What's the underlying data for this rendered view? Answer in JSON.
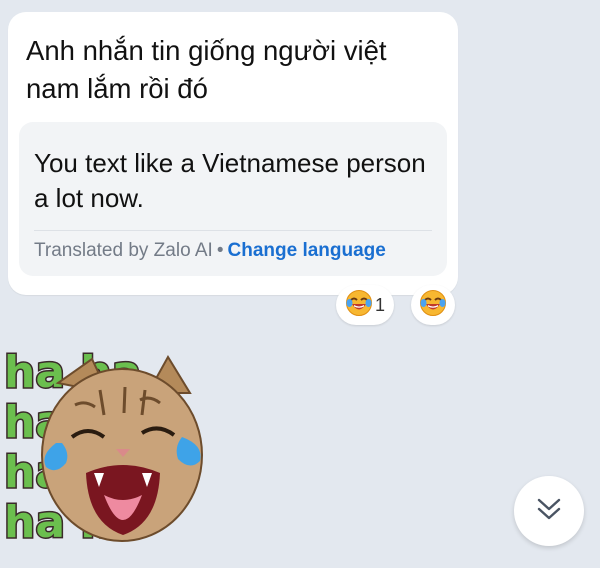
{
  "message": {
    "text": "Anh nhắn tin giống người việt nam lắm rồi đó",
    "translation": {
      "text": "You text like a Vietnamese person a lot now.",
      "credit": "Translated by Zalo AI",
      "separator": "•",
      "change_language": "Change language"
    },
    "reactions": [
      {
        "icon": "laughing-crying-emoji-icon",
        "count": "1"
      }
    ],
    "add_reaction_icon": "laughing-crying-emoji-icon"
  },
  "sticker": {
    "text_rows": [
      "ha ha",
      "ha ha",
      "ha ha",
      "ha ha"
    ],
    "text_color": "#6bbf4e",
    "text_outline": "#3a2a2a",
    "icon": "crying-laughing-cat-icon"
  },
  "scroll_down_icon": "double-chevron-down-icon",
  "colors": {
    "background": "#e3e8ef",
    "bubble": "#ffffff",
    "translation_box": "#f2f4f6",
    "link": "#1a6fd1",
    "muted": "#737b87"
  }
}
